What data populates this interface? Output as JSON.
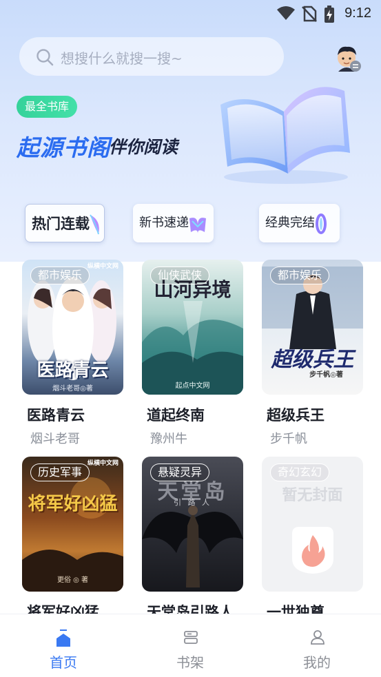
{
  "status_bar": {
    "time": "9:12",
    "icons": [
      "wifi-icon",
      "no-sim-icon",
      "battery-charging-icon"
    ]
  },
  "search": {
    "placeholder": "想搜什么就搜一搜~",
    "icon": "search-icon"
  },
  "avatar": {
    "icon": "user-avatar"
  },
  "brand": {
    "badge": "最全书库",
    "title": "起源书阁",
    "subtitle": "伴你阅读"
  },
  "quick_actions": [
    {
      "label": "热门连载",
      "icon": "gem-icon"
    },
    {
      "label": "新书速递",
      "icon": "gem-icon"
    },
    {
      "label": "经典完结",
      "icon": "gem-icon"
    }
  ],
  "books": [
    {
      "title": "医路青云",
      "author": "烟斗老哥",
      "tag": "都市娱乐",
      "cover_text": "医路青云",
      "cover_small": "烟斗老哥◎著",
      "cover_top": "纵横中文网"
    },
    {
      "title": "道起终南",
      "author": "豫州牛",
      "tag": "仙侠武侠",
      "cover_text": "山河异境",
      "cover_small": "起点中文网",
      "cover_top": ""
    },
    {
      "title": "超级兵王",
      "author": "步千帆",
      "tag": "都市娱乐",
      "cover_text": "超级兵王",
      "cover_small": "步千帆◎著",
      "cover_top": ""
    },
    {
      "title": "将军好凶猛",
      "author": "",
      "tag": "历史军事",
      "cover_text": "将军好凶猛",
      "cover_small": "更俗 ◎ 著",
      "cover_top": "纵横中文网"
    },
    {
      "title": "天堂岛引路人",
      "author": "",
      "tag": "悬疑灵异",
      "cover_text": "天堂岛",
      "cover_small": "引 路 人",
      "cover_top": ""
    },
    {
      "title": "一世独尊",
      "author": "",
      "tag": "奇幻玄幻",
      "cover_text": "暂无封面",
      "cover_small": "",
      "cover_top": ""
    }
  ],
  "bottom_nav": [
    {
      "label": "首页",
      "icon": "home-icon",
      "active": true
    },
    {
      "label": "书架",
      "icon": "bookshelf-icon",
      "active": false
    },
    {
      "label": "我的",
      "icon": "profile-icon",
      "active": false
    }
  ],
  "colors": {
    "accent": "#3a79f2",
    "badge": "#35d29a",
    "brand_title": "#2b6cf0"
  }
}
